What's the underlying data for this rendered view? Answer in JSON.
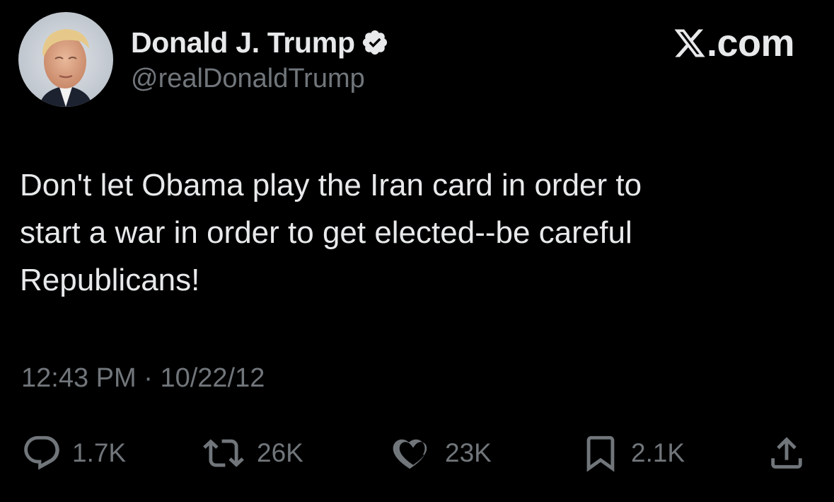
{
  "author": {
    "display_name": "Donald J. Trump",
    "handle": "@realDonaldTrump",
    "verified": true,
    "verified_badge_color": "#e7e9ea"
  },
  "brand": {
    "label": ".com",
    "logo_icon": "x-logo-icon"
  },
  "tweet": {
    "text": "Don't let Obama play the Iran card in order to\nstart a war in order to get elected--be careful\nRepublicans!"
  },
  "meta": {
    "time": "12:43 PM",
    "separator": "·",
    "date": "10/22/12"
  },
  "actions": {
    "reply": {
      "icon": "reply-icon",
      "count": "1.7K"
    },
    "retweet": {
      "icon": "retweet-icon",
      "count": "26K"
    },
    "like": {
      "icon": "heart-icon",
      "count": "23K"
    },
    "bookmark": {
      "icon": "bookmark-icon",
      "count": "2.1K"
    },
    "share": {
      "icon": "share-icon"
    }
  },
  "colors": {
    "background": "#000000",
    "primary_text": "#e7e9ea",
    "secondary_text": "#71767b"
  }
}
